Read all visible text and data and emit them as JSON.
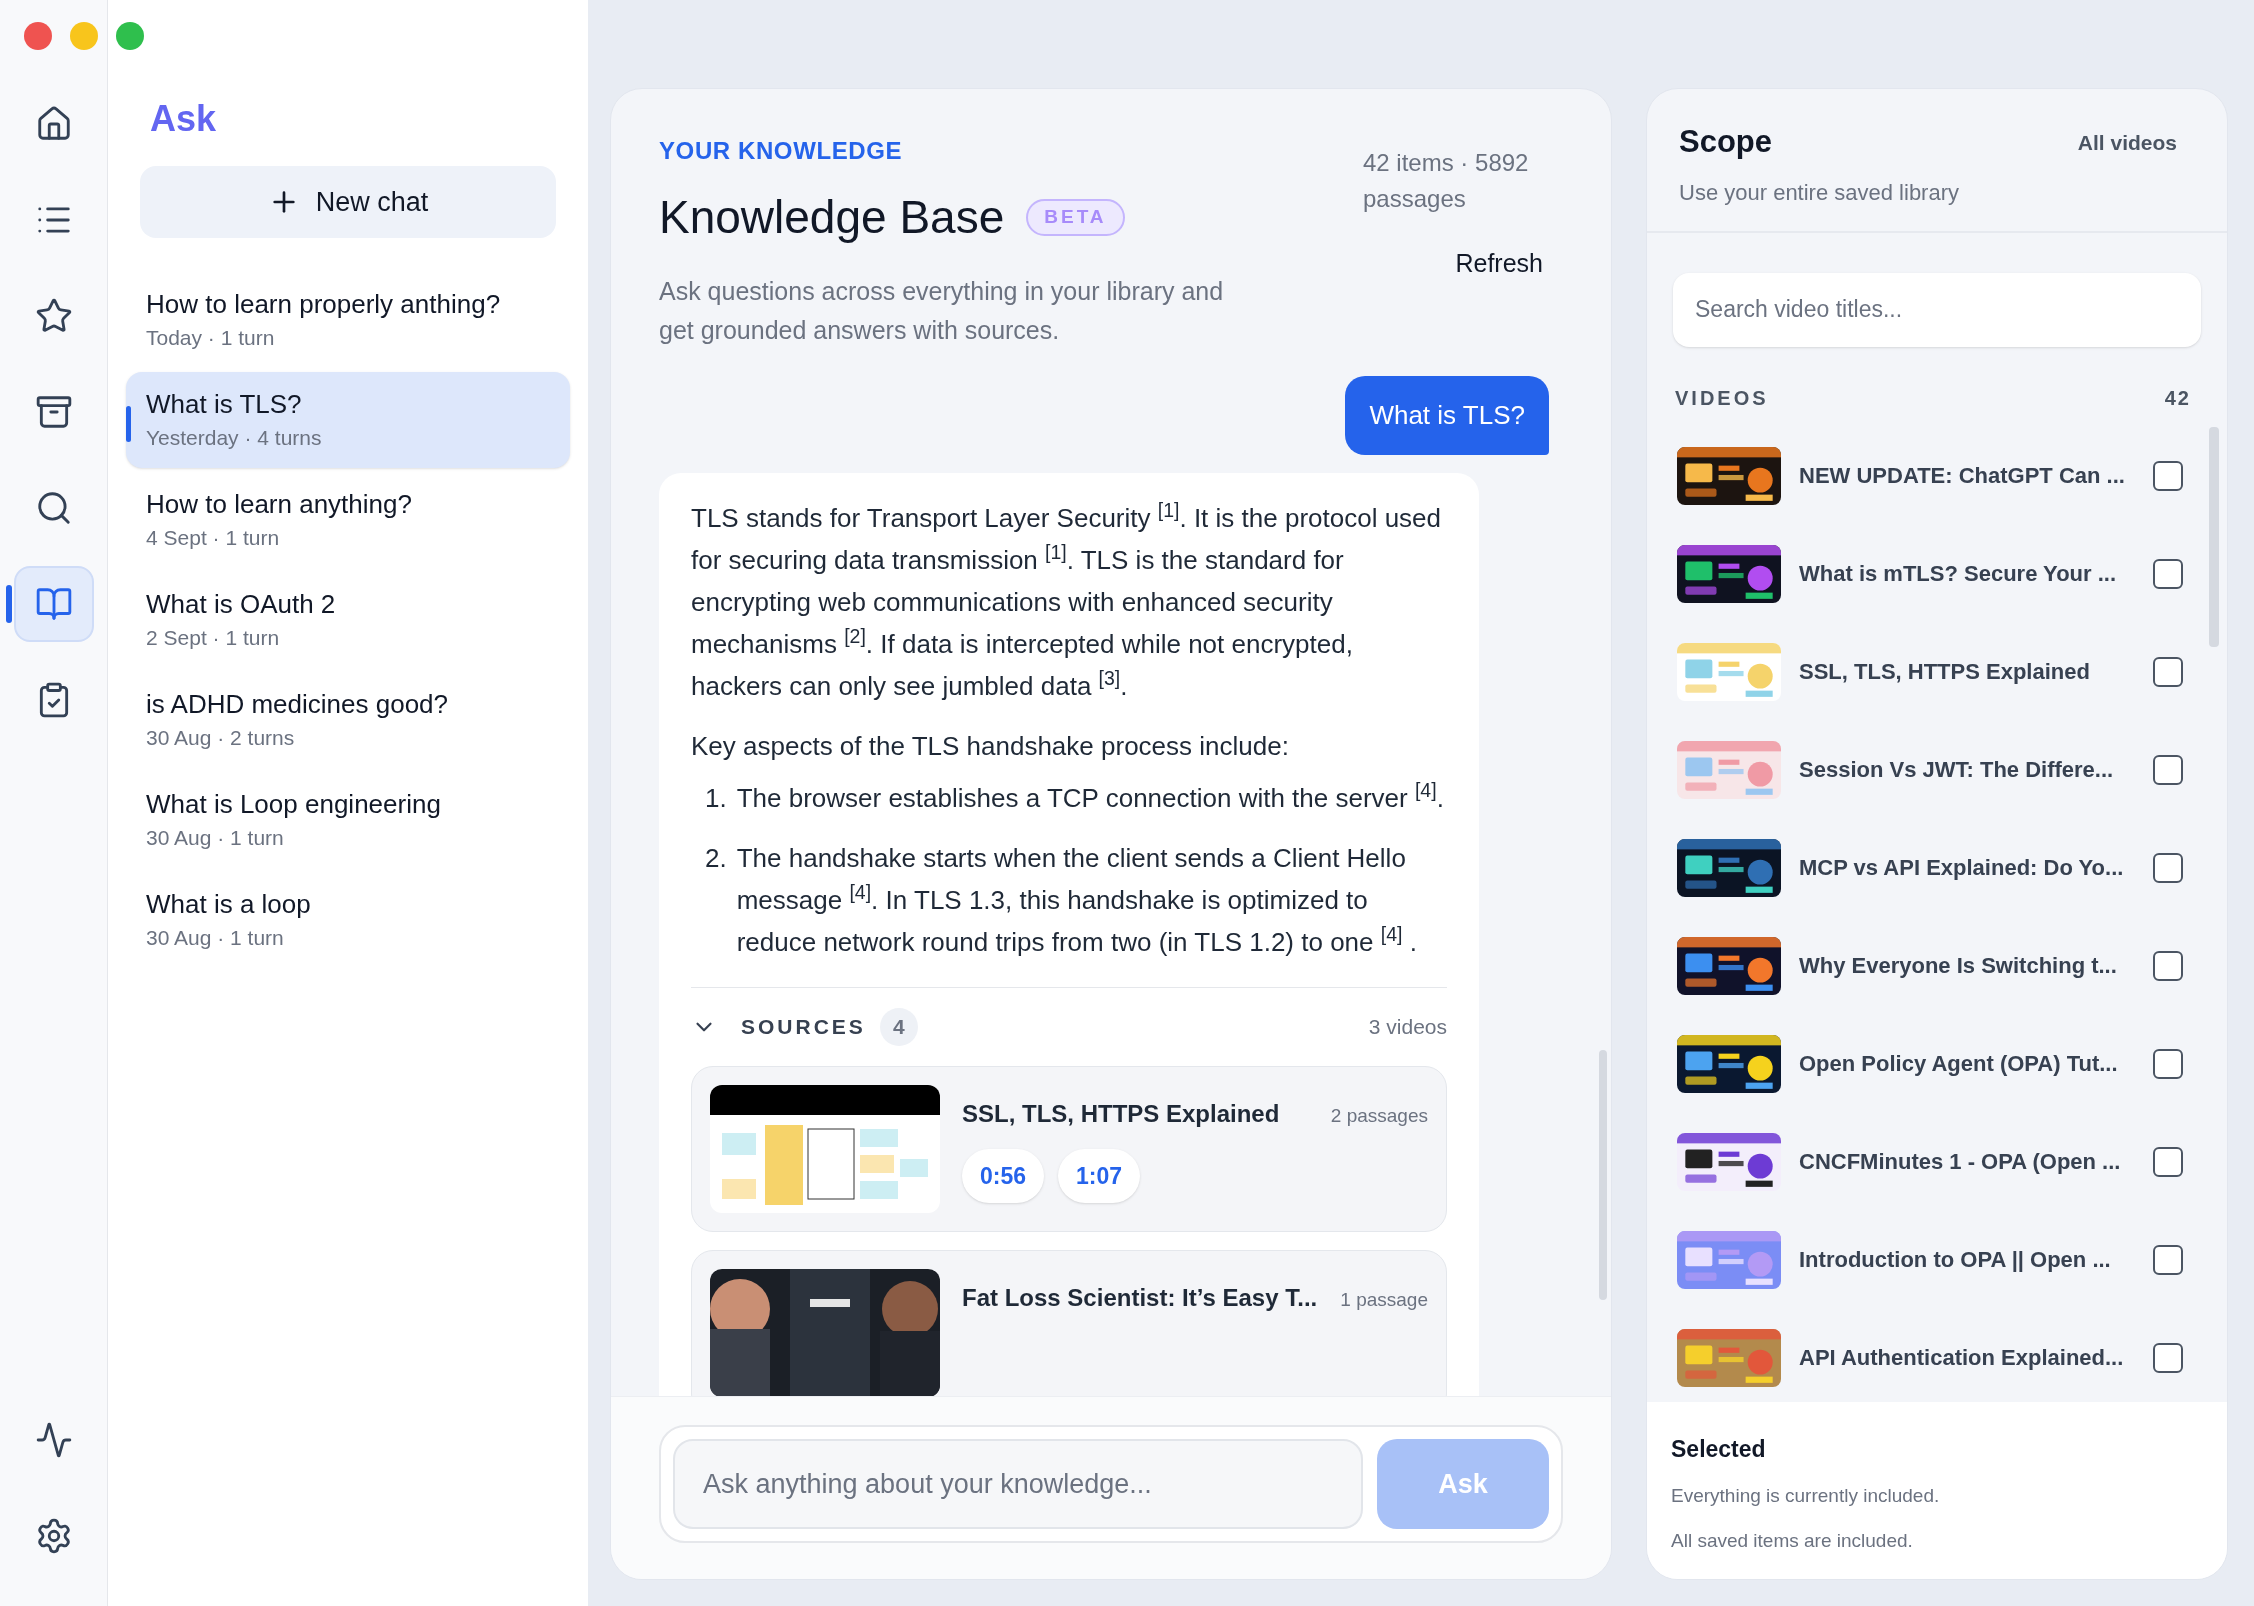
{
  "rail": {
    "items": [
      {
        "kind": "home",
        "selected": false
      },
      {
        "kind": "list",
        "selected": false
      },
      {
        "kind": "star",
        "selected": false
      },
      {
        "kind": "archive",
        "selected": false
      },
      {
        "kind": "search",
        "selected": false
      },
      {
        "kind": "book",
        "selected": true
      },
      {
        "kind": "clipboard",
        "selected": false
      }
    ],
    "bottom": [
      {
        "kind": "activity",
        "selected": false
      },
      {
        "kind": "settings",
        "selected": false
      }
    ]
  },
  "chats": {
    "title": "Ask",
    "new_chat": "New chat",
    "items": [
      {
        "title": "How to learn properly anthing?",
        "meta": "Today · 1 turn",
        "selected": false
      },
      {
        "title": "What is TLS?",
        "meta": "Yesterday · 4 turns",
        "selected": true
      },
      {
        "title": "How to learn anything?",
        "meta": "4 Sept · 1 turn",
        "selected": false
      },
      {
        "title": "What is OAuth 2",
        "meta": "2 Sept · 1 turn",
        "selected": false
      },
      {
        "title": "is ADHD medicines good?",
        "meta": "30 Aug · 2 turns",
        "selected": false
      },
      {
        "title": "What is Loop engineering",
        "meta": "30 Aug · 1 turn",
        "selected": false
      },
      {
        "title": "What is a loop",
        "meta": "30 Aug · 1 turn",
        "selected": false
      }
    ]
  },
  "knowledge": {
    "eyebrow": "YOUR KNOWLEDGE",
    "title": "Knowledge Base",
    "badge": "BETA",
    "stats": "42 items · 5892 passages",
    "refresh": "Refresh",
    "description": "Ask questions across everything in your library and get grounded answers with sources.",
    "question": "What is TLS?",
    "answer": {
      "paragraphs": [
        "TLS stands for Transport Layer Security $^{[1]}$. It is the protocol used for securing data transmission $^{[1]}$. TLS is the standard for encrypting web communications with enhanced security mechanisms $^{[2]}$. If data is intercepted while not encrypted, hackers can only see jumbled data $^{[3]}$.",
        "Key aspects of the TLS handshake process include:"
      ],
      "steps": [
        {
          "number": "1.",
          "text": "The browser establishes a TCP connection with the server $^{[4]}$."
        },
        {
          "number": "2.",
          "text": "The handshake starts when the client sends a Client Hello message $^{[4]}$. In TLS 1.3, this handshake is optimized to reduce network round trips from two (in TLS 1.2) to one $^{[4]}$ ."
        }
      ]
    },
    "sources": {
      "label": "SOURCES",
      "count": "4",
      "summary": "3 videos",
      "expanded": true,
      "items": [
        {
          "title": "SSL, TLS, HTTPS Explained",
          "passages": "2 passages",
          "timestamps": [
            "0:56",
            "1:07"
          ],
          "kind": "diagram"
        },
        {
          "title": "Fat Loss Scientist: It’s Easy T...",
          "passages": "1 passage",
          "kind": "people"
        }
      ]
    },
    "composer": {
      "placeholder": "Ask anything about your knowledge...",
      "button": "Ask",
      "disabled": true
    }
  },
  "scope": {
    "title": "Scope",
    "subtitle": "Use your entire saved library",
    "mode": "All videos",
    "search_placeholder": "Search video titles...",
    "videos_label": "VIDEOS",
    "videos_count": "42",
    "videos": [
      {
        "title": "NEW UPDATE: ChatGPT Can ...",
        "checked": false
      },
      {
        "title": "What is mTLS? Secure Your ...",
        "checked": false
      },
      {
        "title": "SSL, TLS, HTTPS Explained",
        "checked": false
      },
      {
        "title": "Session Vs JWT: The Differe...",
        "checked": false
      },
      {
        "title": "MCP vs API Explained: Do Yo...",
        "checked": false
      },
      {
        "title": "Why Everyone Is Switching t...",
        "checked": false
      },
      {
        "title": "Open Policy Agent (OPA) Tut...",
        "checked": false
      },
      {
        "title": "CNCFMinutes 1 - OPA (Open ...",
        "checked": false
      },
      {
        "title": "Introduction to OPA || Open ...",
        "checked": false
      },
      {
        "title": "API Authentication Explained...",
        "checked": false
      }
    ],
    "selected_title": "Selected",
    "selected_lines": [
      "Everything is currently included.",
      "All saved items are included."
    ]
  }
}
